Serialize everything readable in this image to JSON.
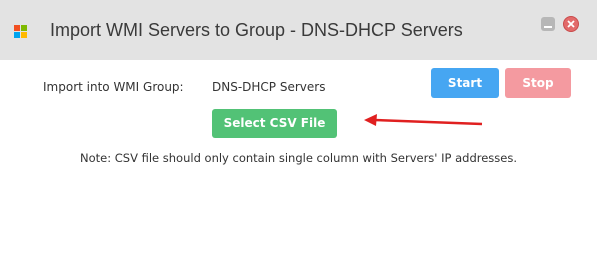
{
  "window": {
    "title": "Import WMI Servers to Group - DNS-DHCP Servers"
  },
  "form": {
    "group_label": "Import into WMI Group:",
    "group_value": "DNS-DHCP Servers",
    "start_label": "Start",
    "stop_label": "Stop",
    "select_csv_label": "Select CSV File",
    "note": "Note: CSV file should only contain single column with Servers' IP addresses."
  },
  "colors": {
    "start": "#46a6f2",
    "stop": "#f49aa0",
    "select_csv": "#52c276",
    "arrow": "#e02020",
    "titlebar": "#e3e3e3"
  },
  "icons": [
    "windows-logo-icon",
    "minimize-icon",
    "close-icon",
    "red-arrow-annotation"
  ]
}
